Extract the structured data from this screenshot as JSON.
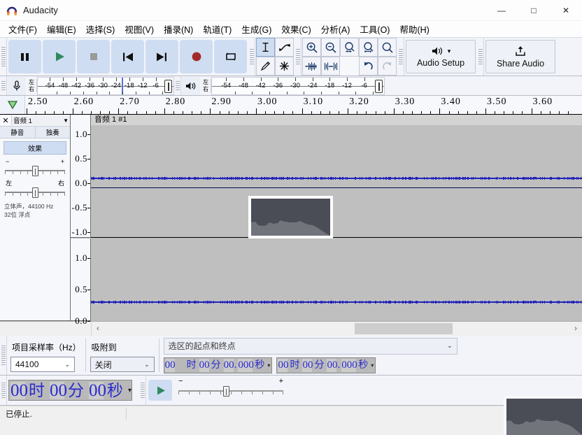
{
  "window": {
    "title": "Audacity",
    "icon": "audacity-logo-icon",
    "minimize": "—",
    "maximize": "□",
    "close": "✕"
  },
  "menubar": {
    "items": [
      {
        "label": "文件(F)",
        "name": "menu-file"
      },
      {
        "label": "编辑(E)",
        "name": "menu-edit"
      },
      {
        "label": "选择(S)",
        "name": "menu-select"
      },
      {
        "label": "视图(V)",
        "name": "menu-view"
      },
      {
        "label": "播录(N)",
        "name": "menu-transport"
      },
      {
        "label": "轨道(T)",
        "name": "menu-tracks"
      },
      {
        "label": "生成(G)",
        "name": "menu-generate"
      },
      {
        "label": "效果(C)",
        "name": "menu-effect"
      },
      {
        "label": "分析(A)",
        "name": "menu-analyze"
      },
      {
        "label": "工具(O)",
        "name": "menu-tools"
      },
      {
        "label": "帮助(H)",
        "name": "menu-help"
      }
    ]
  },
  "transport": {
    "buttons": [
      {
        "name": "pause-button",
        "icon": "pause-icon"
      },
      {
        "name": "play-button",
        "icon": "play-icon"
      },
      {
        "name": "stop-button",
        "icon": "stop-icon"
      },
      {
        "name": "skip-to-start-button",
        "icon": "skip-start-icon"
      },
      {
        "name": "skip-to-end-button",
        "icon": "skip-end-icon"
      },
      {
        "name": "record-button",
        "icon": "record-icon"
      },
      {
        "name": "loop-button",
        "icon": "loop-icon"
      }
    ],
    "colors": {
      "play": "#2f8a5f",
      "record": "#a32a2a",
      "stop": "#9a9a9a",
      "button_bg": "#cfddf2"
    }
  },
  "tools": {
    "items": [
      {
        "name": "selection-tool",
        "icon": "i-beam-icon",
        "selected": true
      },
      {
        "name": "envelope-tool",
        "icon": "envelope-icon",
        "selected": false
      },
      {
        "name": "draw-tool",
        "icon": "pencil-icon",
        "selected": false
      },
      {
        "name": "multi-tool",
        "icon": "asterisk-icon",
        "selected": false
      }
    ]
  },
  "edit_toolbar": {
    "items": [
      {
        "name": "zoom-in-button",
        "icon": "zoom-in-icon"
      },
      {
        "name": "zoom-out-button",
        "icon": "zoom-out-icon"
      },
      {
        "name": "fit-selection-button",
        "icon": "zoom-fit-selection-icon"
      },
      {
        "name": "fit-project-button",
        "icon": "zoom-fit-project-icon"
      },
      {
        "name": "zoom-toggle-button",
        "icon": "zoom-toggle-icon"
      },
      {
        "name": "trim-audio-button",
        "icon": "trim-outside-icon"
      },
      {
        "name": "silence-audio-button",
        "icon": "silence-selection-icon"
      },
      {
        "name": "undo-button",
        "icon": "undo-icon"
      },
      {
        "name": "redo-button",
        "icon": "redo-icon",
        "disabled": true
      }
    ]
  },
  "audio_setup": {
    "label": "Audio Setup",
    "icon": "speaker-icon",
    "chevron": "▾"
  },
  "share_audio": {
    "label": "Share Audio",
    "icon": "upload-icon"
  },
  "meters": {
    "record": {
      "name": "recording-meter",
      "icon": "microphone-icon",
      "left_label": "左",
      "right_label": "右",
      "scale": [
        "-54",
        "-48",
        "-42",
        "-36",
        "-30",
        "-24",
        "-18",
        "-12",
        "-6"
      ],
      "playhead_at": "-24"
    },
    "play": {
      "name": "playback-meter",
      "icon": "speaker-icon",
      "left_label": "左",
      "right_label": "右",
      "scale": [
        "-54",
        "-48",
        "-42",
        "-36",
        "-30",
        "-24",
        "-18",
        "-12",
        "-6"
      ]
    }
  },
  "timeline": {
    "pin_icon": "pinned-play-head-icon",
    "labels": [
      "2.50",
      "2.60",
      "2.70",
      "2.80",
      "2.90",
      "3.00",
      "3.10",
      "3.20",
      "3.30",
      "3.40",
      "3.50",
      "3.60"
    ]
  },
  "track": {
    "close_icon": "✕",
    "name": "音频 1",
    "menu_chevron": "▼",
    "mute_label": "静音",
    "solo_label": "独奏",
    "effects_label": "效果",
    "gain": {
      "minus": "−",
      "plus": "+",
      "value": 50
    },
    "pan": {
      "left": "左",
      "right": "右",
      "value": 50
    },
    "info_line1": "立体声，44100 Hz",
    "info_line2": "32位 浮点",
    "clip_title": "音频 1 #1",
    "channel1_ruler": [
      "1.0",
      "0.5",
      "0.0",
      "-0.5",
      "-1.0"
    ],
    "channel2_ruler": [
      "1.0",
      "0.5",
      "0.0"
    ],
    "waveform_color": "#2222bb"
  },
  "drag_thumbnail": {
    "name": "dragged-image-thumbnail",
    "fill": "#4a4d56",
    "low_fill": "#71747b"
  },
  "scrollbar": {
    "left_arrow": "‹",
    "right_arrow": "›"
  },
  "selection_toolbar": {
    "sample_rate_label": "项目采样率（Hz）",
    "sample_rate_value": "44100",
    "snap_label": "吸附到",
    "snap_value": "关闭",
    "selection_label": "选区的起点和终点",
    "start_time": {
      "name": "selection-start-time",
      "hh": "00",
      "hh_unit": "时",
      "mm": "00",
      "mm_unit": "分",
      "ss": "00",
      "ms": "000",
      "ss_unit": "秒"
    },
    "end_time": {
      "name": "selection-end-time",
      "hh": "00",
      "hh_unit": "时",
      "mm": "00",
      "mm_unit": "分",
      "ss": "00",
      "ms": "000",
      "ss_unit": "秒"
    },
    "chevron": "▾"
  },
  "audio_position": {
    "name": "audio-position-time",
    "hh": "00",
    "hh_unit": "时",
    "mm": "00",
    "mm_unit": "分",
    "ss": "00",
    "ss_unit": "秒",
    "chevron": "▾"
  },
  "play_at_speed": {
    "play_icon": "play-icon",
    "minus": "−",
    "plus": "+",
    "value": 45
  },
  "statusbar": {
    "message": "已停止."
  }
}
